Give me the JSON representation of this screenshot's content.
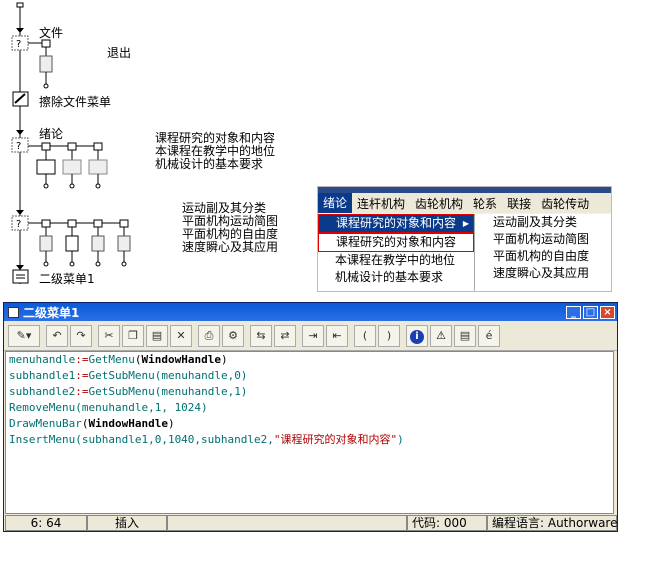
{
  "flowline": {
    "items": [
      {
        "label": "文件"
      },
      {
        "label": "擦除文件菜单"
      },
      {
        "label": "绪论"
      },
      {
        "label": "二级菜单1"
      }
    ],
    "exit_label": "退出",
    "intro_topics": [
      "课程研究的对象和内容",
      "本课程在教学中的地位",
      "机械设计的基本要求"
    ],
    "second_topics": [
      "运动副及其分类",
      "平面机构运动简图",
      "平面机构的自由度",
      "速度瞬心及其应用"
    ]
  },
  "menu_preview": {
    "menubar": [
      "绪论",
      "连杆机构",
      "齿轮机构",
      "轮系",
      "联接",
      "齿轮传动"
    ],
    "active_index": 0,
    "submenu": [
      "课程研究的对象和内容",
      "课程研究的对象和内容",
      "本课程在教学中的地位",
      "机械设计的基本要求"
    ],
    "submenu_arrow": "▶",
    "subsubmenu": [
      "运动副及其分类",
      "平面机构运动简图",
      "平面机构的自由度",
      "速度瞬心及其应用"
    ]
  },
  "editor": {
    "title": "二级菜单1",
    "title_buttons": [
      "_",
      "□",
      "×"
    ],
    "toolbar_icons": [
      "tools-icon",
      "undo-icon",
      "redo-icon",
      "cut-icon",
      "copy-icon",
      "paste-icon",
      "delete-icon",
      "print-icon",
      "settings-icon",
      "replace-icon",
      "find-icon",
      "indent-icon",
      "outdent-icon",
      "paren-open-icon",
      "paren-close-icon",
      "info-icon",
      "warning-icon",
      "document-icon",
      "accent-icon"
    ],
    "code_lines": [
      [
        {
          "t": "menuhandle",
          "c": "fn"
        },
        {
          "t": ":=",
          "c": "str"
        },
        {
          "t": "GetMenu",
          "c": "fn"
        },
        {
          "t": "(",
          "c": "punc"
        },
        {
          "t": "WindowHandle",
          "c": "kw"
        },
        {
          "t": ")",
          "c": "punc"
        }
      ],
      [
        {
          "t": "subhandle1",
          "c": "fn"
        },
        {
          "t": ":=",
          "c": "str"
        },
        {
          "t": "GetSubMenu",
          "c": "fn"
        },
        {
          "t": "(menuhandle,0)",
          "c": "fn"
        }
      ],
      [
        {
          "t": "subhandle2",
          "c": "fn"
        },
        {
          "t": ":=",
          "c": "str"
        },
        {
          "t": "GetSubMenu",
          "c": "fn"
        },
        {
          "t": "(menuhandle,1)",
          "c": "fn"
        }
      ],
      [
        {
          "t": "RemoveMenu(menuhandle,1, 1024)",
          "c": "fn"
        }
      ],
      [
        {
          "t": "DrawMenuBar",
          "c": "fn"
        },
        {
          "t": "(",
          "c": "punc"
        },
        {
          "t": "WindowHandle",
          "c": "kw"
        },
        {
          "t": ")",
          "c": "punc"
        }
      ],
      [
        {
          "t": "InsertMenu(subhandle1,0,1040,subhandle2,",
          "c": "fn"
        },
        {
          "t": "\"课程研究的对象和内容\"",
          "c": "str"
        },
        {
          "t": ")",
          "c": "fn"
        }
      ]
    ],
    "status": {
      "position": "6: 64",
      "mode": "插入",
      "empty1": "",
      "code": "代码: 000",
      "language": "编程语言: Authorware"
    }
  }
}
